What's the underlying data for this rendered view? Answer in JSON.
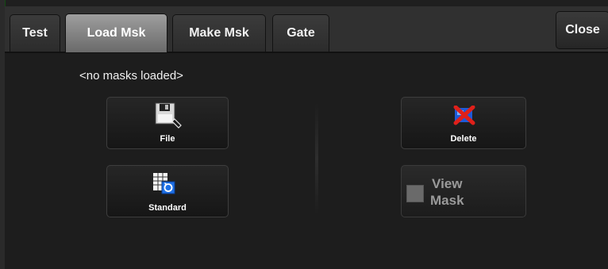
{
  "tabs": [
    {
      "label": "Test",
      "active": false
    },
    {
      "label": "Load Msk",
      "active": true
    },
    {
      "label": "Make Msk",
      "active": false
    },
    {
      "label": "Gate",
      "active": false
    }
  ],
  "close_label": "Close",
  "status_text": "<no masks loaded>",
  "buttons": {
    "file": {
      "label": "File",
      "icon": "floppy-disk-icon"
    },
    "standard": {
      "label": "Standard",
      "icon": "standard-mask-icon"
    },
    "delete": {
      "label": "Delete",
      "icon": "delete-x-icon"
    },
    "view_mask": {
      "line1": "View",
      "line2": "Mask",
      "checked": false
    }
  },
  "colors": {
    "panel_bg": "#1d1d1d",
    "active_tab": "#8a8a8a",
    "delete_red": "#e0201a",
    "delete_blue": "#1e5ad8"
  }
}
